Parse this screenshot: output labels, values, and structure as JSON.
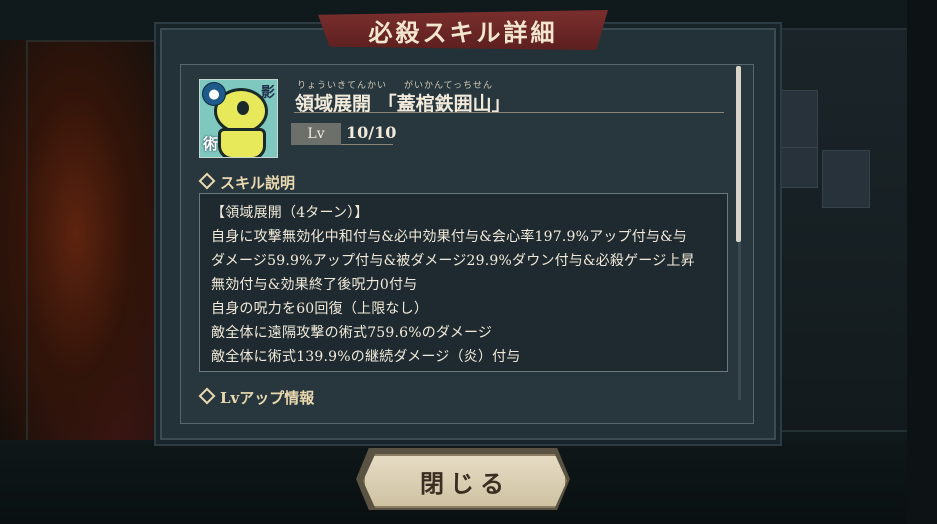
{
  "dialog": {
    "title": "必殺スキル詳細",
    "close_label": "閉じる"
  },
  "skill": {
    "icon_tags": {
      "top": "影",
      "bottom": "術"
    },
    "ruby_left": "りょういきてんかい",
    "ruby_right": "がいかんてっちせん",
    "name": "領域展開 「蓋棺鉄囲山」",
    "lv_label": "Lv",
    "lv_value": "10/10"
  },
  "description": {
    "heading": "スキル説明",
    "lines": [
      "【領域展開（4ターン）】",
      "自身に攻撃無効化中和付与&必中効果付与&会心率197.9%アップ付与&与",
      "ダメージ59.9%アップ付与&被ダメージ29.9%ダウン付与&必殺ゲージ上昇",
      "無効付与&効果終了後呪力0付与",
      "自身の呪力を60回復（上限なし）",
      "敵全体に遠隔攻撃の術式759.6%のダメージ",
      "敵全体に術式139.9%の継続ダメージ（炎）付与"
    ]
  },
  "lvup": {
    "heading": "Lvアップ情報"
  },
  "colors": {
    "title_plate": "#6e2828",
    "panel": "#223238",
    "text": "#f1eadb",
    "accent": "#ead9b0"
  }
}
